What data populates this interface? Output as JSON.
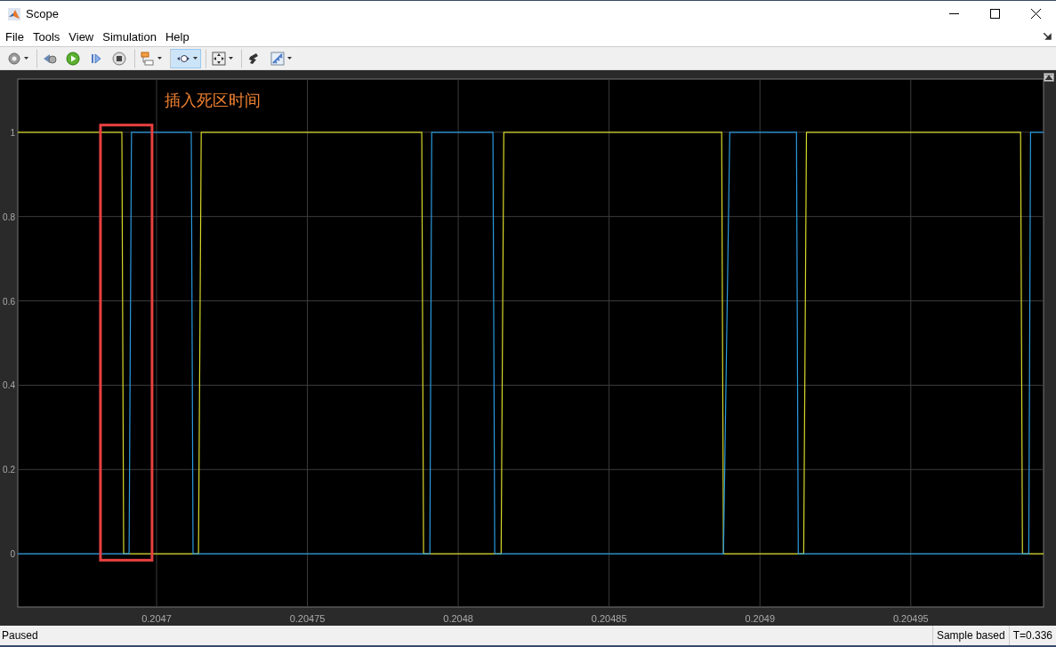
{
  "window": {
    "title": "Scope"
  },
  "menu": [
    "File",
    "Tools",
    "View",
    "Simulation",
    "Help"
  ],
  "toolbar": [
    {
      "kind": "settings",
      "selected": false,
      "dropdown": true,
      "group_start": false
    },
    {
      "kind": "step_back",
      "selected": false,
      "dropdown": false,
      "group_start": true
    },
    {
      "kind": "run",
      "selected": false,
      "dropdown": false,
      "group_start": false
    },
    {
      "kind": "step_forward",
      "selected": false,
      "dropdown": false,
      "group_start": false
    },
    {
      "kind": "stop",
      "selected": false,
      "dropdown": false,
      "group_start": false
    },
    {
      "kind": "signals",
      "selected": false,
      "dropdown": true,
      "group_start": true
    },
    {
      "kind": "zoom_x",
      "selected": true,
      "dropdown": true,
      "group_start": true
    },
    {
      "kind": "fit",
      "selected": false,
      "dropdown": true,
      "group_start": true
    },
    {
      "kind": "highlight",
      "selected": false,
      "dropdown": false,
      "group_start": true
    },
    {
      "kind": "measure",
      "selected": false,
      "dropdown": true,
      "group_start": false
    }
  ],
  "plot": {
    "chart_data": {
      "type": "line",
      "x": [
        0.204654,
        0.2046885,
        0.2046891,
        0.2046909,
        0.2046917,
        0.2047115,
        0.2047121,
        0.2047139,
        0.2047148,
        0.2047879,
        0.2047885,
        0.2047906,
        0.2047912,
        0.2048115,
        0.2048121,
        0.2048142,
        0.2048151,
        0.2048873,
        0.2048879,
        0.20489,
        0.2048906,
        0.2049121,
        0.2049127,
        0.2049145,
        0.2049154,
        0.2049864,
        0.204987,
        0.2049891,
        0.2049897,
        0.204994
      ],
      "series": [
        {
          "color": "#d8d82a",
          "values": [
            1,
            1,
            0,
            0,
            0,
            0,
            0,
            0,
            1,
            1,
            0,
            0,
            0,
            0,
            0,
            0,
            1,
            1,
            0,
            0,
            0,
            0,
            0,
            0,
            1,
            1,
            0,
            0,
            0,
            0
          ]
        },
        {
          "color": "#2a9ae0",
          "values": [
            0,
            0,
            0,
            0,
            1,
            1,
            0,
            0,
            0,
            0,
            0,
            0,
            1,
            1,
            0,
            0,
            0,
            0,
            0,
            1,
            1,
            1,
            0,
            0,
            0,
            0,
            0,
            0,
            1,
            1
          ]
        }
      ],
      "xlim": [
        0.204654,
        0.204994
      ],
      "ylim": [
        -0.126,
        1.126
      ],
      "xticks": [
        {
          "value": 0.2047,
          "label": "0.2047"
        },
        {
          "value": 0.20475,
          "label": "0.20475"
        },
        {
          "value": 0.2048,
          "label": "0.2048"
        },
        {
          "value": 0.20485,
          "label": "0.20485"
        },
        {
          "value": 0.2049,
          "label": "0.2049"
        },
        {
          "value": 0.20495,
          "label": "0.20495"
        }
      ],
      "yticks": [
        {
          "value": 0,
          "label": "0"
        },
        {
          "value": 0.2,
          "label": "0.2"
        },
        {
          "value": 0.4,
          "label": "0.4"
        },
        {
          "value": 0.6,
          "label": "0.6"
        },
        {
          "value": 0.8,
          "label": "0.8"
        },
        {
          "value": 1,
          "label": "1"
        }
      ],
      "grid": true,
      "annotations": [
        "插入死区时间"
      ]
    },
    "highlight_box": {
      "color": "#e84040"
    }
  },
  "status_bar": {
    "state": "Paused",
    "mode": "Sample based",
    "time": "T=0.336"
  }
}
